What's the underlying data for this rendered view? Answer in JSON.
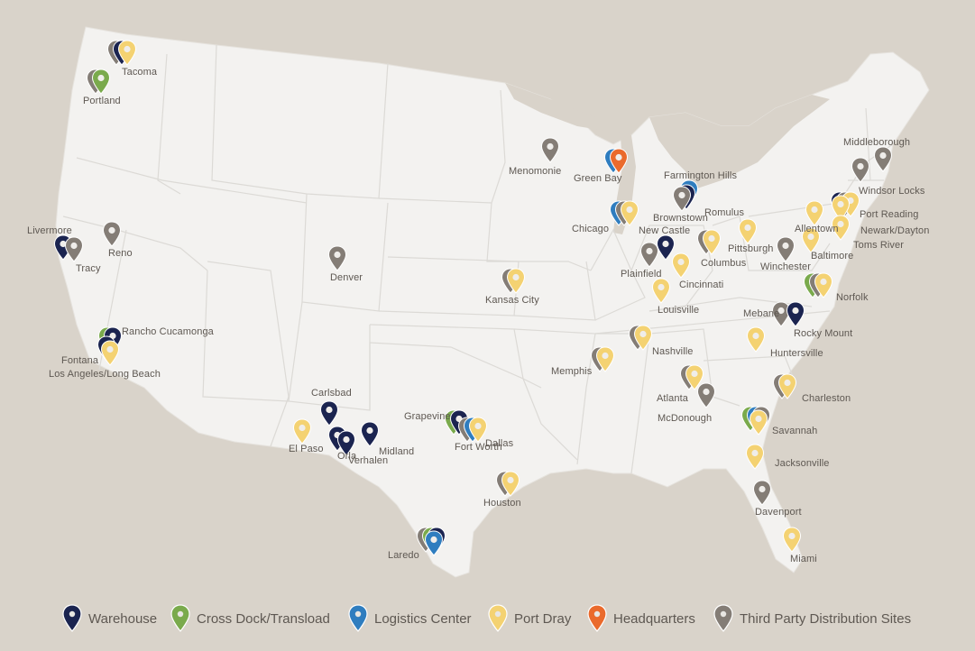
{
  "colors": {
    "warehouse": "#1b2450",
    "crossdock": "#7aaa4c",
    "logistics": "#2f7dbf",
    "portdray": "#f4d272",
    "headquarters": "#ea6a2c",
    "thirdparty": "#847d76",
    "land": "#f3f2f0",
    "water": "#d9d3ca",
    "borders": "#dcdad6"
  },
  "legend": [
    {
      "key": "warehouse",
      "label": "Warehouse"
    },
    {
      "key": "crossdock",
      "label": "Cross Dock/Transload"
    },
    {
      "key": "logistics",
      "label": "Logistics Center"
    },
    {
      "key": "portdray",
      "label": "Port Dray"
    },
    {
      "key": "headquarters",
      "label": "Headquarters"
    },
    {
      "key": "thirdparty",
      "label": "Third Party Distribution Sites"
    }
  ],
  "locations": [
    {
      "name": "Tacoma",
      "pins": [
        "thirdparty",
        "warehouse",
        "portdray"
      ]
    },
    {
      "name": "Portland",
      "pins": [
        "thirdparty",
        "crossdock"
      ]
    },
    {
      "name": "Livermore",
      "pins": [
        "warehouse"
      ]
    },
    {
      "name": "Tracy",
      "pins": [
        "thirdparty"
      ]
    },
    {
      "name": "Reno",
      "pins": [
        "thirdparty"
      ]
    },
    {
      "name": "Rancho Cucamonga",
      "pins": [
        "crossdock",
        "warehouse"
      ]
    },
    {
      "name": "Fontana",
      "pins": [
        "warehouse"
      ]
    },
    {
      "name": "Los Angeles/Long Beach",
      "pins": [
        "portdray"
      ]
    },
    {
      "name": "Denver",
      "pins": [
        "thirdparty"
      ]
    },
    {
      "name": "Carlsbad",
      "pins": [
        "warehouse"
      ]
    },
    {
      "name": "El Paso",
      "pins": [
        "portdray"
      ]
    },
    {
      "name": "Orla",
      "pins": [
        "warehouse"
      ]
    },
    {
      "name": "Verhalen",
      "pins": [
        "warehouse"
      ]
    },
    {
      "name": "Midland",
      "pins": [
        "warehouse"
      ]
    },
    {
      "name": "Grapevine",
      "pins": [
        "crossdock",
        "warehouse"
      ]
    },
    {
      "name": "Fort Worth",
      "pins": [
        "thirdparty",
        "logistics"
      ]
    },
    {
      "name": "Dallas",
      "pins": [
        "portdray"
      ]
    },
    {
      "name": "Houston",
      "pins": [
        "thirdparty",
        "portdray"
      ]
    },
    {
      "name": "Laredo",
      "pins": [
        "thirdparty",
        "crossdock",
        "warehouse",
        "logistics"
      ]
    },
    {
      "name": "Kansas City",
      "pins": [
        "thirdparty",
        "portdray"
      ]
    },
    {
      "name": "Menomonie",
      "pins": [
        "thirdparty"
      ]
    },
    {
      "name": "Green Bay",
      "pins": [
        "logistics",
        "headquarters"
      ]
    },
    {
      "name": "Chicago",
      "pins": [
        "logistics",
        "thirdparty",
        "portdray"
      ]
    },
    {
      "name": "Farmington Hills",
      "pins": [
        "logistics"
      ]
    },
    {
      "name": "Romulus",
      "pins": [
        "warehouse"
      ]
    },
    {
      "name": "Brownstown",
      "pins": [
        "thirdparty"
      ]
    },
    {
      "name": "New Castle",
      "pins": [
        "warehouse"
      ]
    },
    {
      "name": "Plainfield",
      "pins": [
        "thirdparty"
      ]
    },
    {
      "name": "Columbus",
      "pins": [
        "thirdparty",
        "portdray"
      ]
    },
    {
      "name": "Cincinnati",
      "pins": [
        "portdray"
      ]
    },
    {
      "name": "Louisville",
      "pins": [
        "portdray"
      ]
    },
    {
      "name": "Pittsburgh",
      "pins": [
        "portdray"
      ]
    },
    {
      "name": "Middleborough",
      "pins": [
        "thirdparty"
      ]
    },
    {
      "name": "Windsor Locks",
      "pins": [
        "thirdparty"
      ]
    },
    {
      "name": "Allentown",
      "pins": [
        "portdray"
      ]
    },
    {
      "name": "Port Reading",
      "pins": [
        "warehouse",
        "thirdparty",
        "portdray"
      ]
    },
    {
      "name": "Newark/Dayton",
      "pins": [
        "portdray"
      ]
    },
    {
      "name": "Toms River",
      "pins": [
        "portdray"
      ]
    },
    {
      "name": "Winchester",
      "pins": [
        "thirdparty"
      ]
    },
    {
      "name": "Baltimore",
      "pins": [
        "portdray"
      ]
    },
    {
      "name": "Norfolk",
      "pins": [
        "crossdock",
        "thirdparty",
        "portdray"
      ]
    },
    {
      "name": "Mebane",
      "pins": [
        "thirdparty"
      ]
    },
    {
      "name": "Rocky Mount",
      "pins": [
        "warehouse"
      ]
    },
    {
      "name": "Huntersville",
      "pins": [
        "portdray"
      ]
    },
    {
      "name": "Nashville",
      "pins": [
        "thirdparty",
        "portdray"
      ]
    },
    {
      "name": "Memphis",
      "pins": [
        "thirdparty",
        "portdray"
      ]
    },
    {
      "name": "Atlanta",
      "pins": [
        "thirdparty",
        "portdray"
      ]
    },
    {
      "name": "McDonough",
      "pins": [
        "thirdparty"
      ]
    },
    {
      "name": "Charleston",
      "pins": [
        "thirdparty",
        "portdray"
      ]
    },
    {
      "name": "Savannah",
      "pins": [
        "crossdock",
        "logistics",
        "thirdparty",
        "portdray"
      ]
    },
    {
      "name": "Jacksonville",
      "pins": [
        "portdray"
      ]
    },
    {
      "name": "Davenport",
      "pins": [
        "thirdparty"
      ]
    },
    {
      "name": "Miami",
      "pins": [
        "portdray"
      ]
    }
  ]
}
